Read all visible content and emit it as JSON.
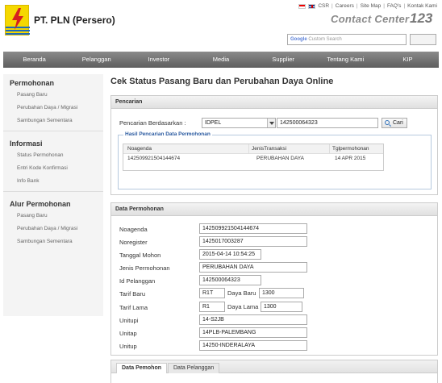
{
  "header": {
    "brand": "PT. PLN (Persero)",
    "links": [
      "CSR",
      "Careers",
      "Site Map",
      "FAQ's",
      "Kontak Kami"
    ],
    "contact_center_text": "Contact Center",
    "contact_center_num": "123",
    "search_brand": "Google",
    "search_placeholder": "Custom Search"
  },
  "nav": [
    "Beranda",
    "Pelanggan",
    "Investor",
    "Media",
    "Supplier",
    "Tentang Kami",
    "KIP"
  ],
  "sidebar": [
    {
      "title": "Permohonan",
      "items": [
        "Pasang Baru",
        "Perubahan Daya / Migrasi",
        "Sambungan Sementara"
      ]
    },
    {
      "title": "Informasi",
      "items": [
        "Status Permohonan",
        "Entri Kode Konfirmasi",
        "Info Bank"
      ]
    },
    {
      "title": "Alur Permohonan",
      "items": [
        "Pasang Baru",
        "Perubahan Daya / Migrasi",
        "Sambungan Sementara"
      ]
    }
  ],
  "page_title": "Cek Status Pasang Baru dan Perubahan Daya Online",
  "pencarian": {
    "heading": "Pencarian",
    "label": "Pencarian Berdasarkan :",
    "select_value": "IDPEL",
    "input_value": "142500064323",
    "button": "Cari",
    "results_legend": "Hasil Pencarian Data Permohonan",
    "columns": [
      "Noagenda",
      "JenisTransaksi",
      "Tglpermohonan"
    ],
    "rows": [
      [
        "142509921504144674",
        "PERUBAHAN DAYA",
        "14 APR 2015"
      ]
    ]
  },
  "data_permohonan": {
    "heading": "Data Permohonan",
    "noagenda_label": "Noagenda",
    "noagenda": "142509921504144674",
    "noregister_label": "Noregister",
    "noregister": "1425017003287",
    "tanggal_label": "Tanggal Mohon",
    "tanggal": "2015-04-14 10:54:25",
    "jenis_label": "Jenis Permohonan",
    "jenis": "PERUBAHAN DAYA",
    "idpel_label": "Id Pelanggan",
    "idpel": "142500064323",
    "tarif_baru_label": "Tarif Baru",
    "tarif_baru": "R1T",
    "daya_baru_label": "Daya Baru",
    "daya_baru": "1300",
    "tarif_lama_label": "Tarif Lama",
    "tarif_lama": "R1",
    "daya_lama_label": "Daya Lama",
    "daya_lama": "1300",
    "unitupi_label": "Unitupi",
    "unitupi": "14-S2JB",
    "unitap_label": "Unitap",
    "unitap": "14PLB-PALEMBANG",
    "unitup_label": "Unitup",
    "unitup": "14250-INDERALAYA"
  },
  "tabs": [
    "Data Pemohon",
    "Data Pelanggan"
  ]
}
